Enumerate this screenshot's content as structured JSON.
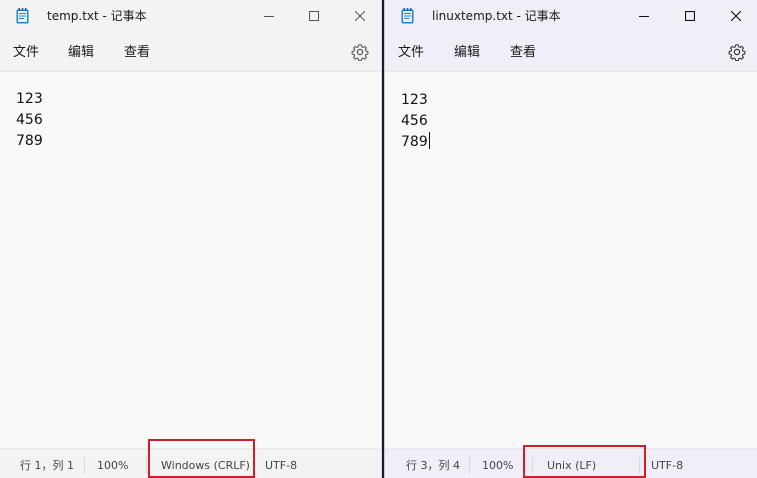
{
  "colors": {
    "highlight": "#d11f2a",
    "icon_blue": "#2e7fc9"
  },
  "left": {
    "title": "temp.txt - 记事本",
    "menu": [
      "文件",
      "编辑",
      "查看"
    ],
    "lines": [
      "123",
      "456",
      "789"
    ],
    "status": {
      "position": "行 1，列 1",
      "zoom": "100%",
      "line_ending": "Windows (CRLF)",
      "encoding": "UTF-8"
    }
  },
  "right": {
    "title": "linuxtemp.txt - 记事本",
    "menu": [
      "文件",
      "编辑",
      "查看"
    ],
    "lines": [
      "123",
      "456",
      "789"
    ],
    "status": {
      "position": "行 3，列 4",
      "zoom": "100%",
      "line_ending": "Unix (LF)",
      "encoding": "UTF-8"
    }
  },
  "icons": [
    "notepad-icon",
    "minimize-icon",
    "maximize-icon",
    "close-icon",
    "settings-gear-icon"
  ]
}
